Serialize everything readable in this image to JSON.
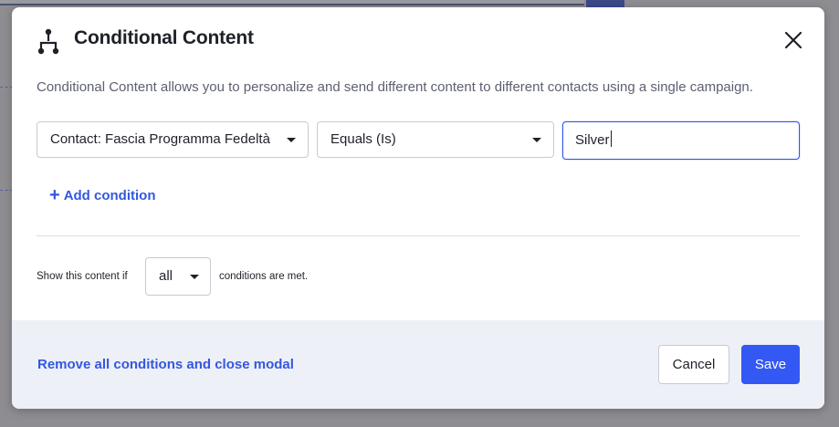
{
  "colors": {
    "accent": "#3358f4",
    "link": "#3358e0",
    "footer_bg": "#eef0f7",
    "input_focus": "#2f54eb"
  },
  "modal": {
    "icon": "branch-icon",
    "title": "Conditional Content",
    "close_icon": "close-icon",
    "description": "Conditional Content allows you to personalize and send different content to different contacts using a single campaign."
  },
  "condition": {
    "field": "Contact: Fascia Programma Fedeltà",
    "operator": "Equals (Is)",
    "value": "Silver"
  },
  "add_condition_label": "Add condition",
  "match": {
    "prefix": "Show this content if",
    "selected": "all",
    "suffix": "conditions are met."
  },
  "footer": {
    "remove_label": "Remove all conditions and close modal",
    "cancel_label": "Cancel",
    "save_label": "Save"
  }
}
